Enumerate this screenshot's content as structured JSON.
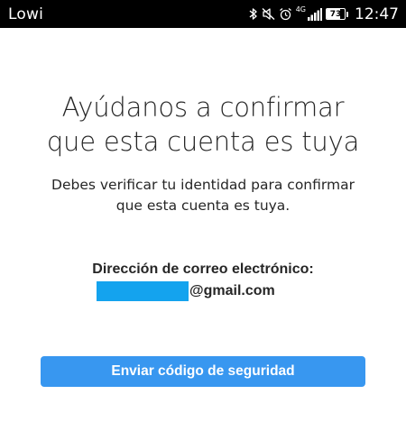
{
  "status_bar": {
    "carrier": "Lowi",
    "network_type": "4G",
    "battery_level": "73",
    "battery_fraction": 0.73,
    "time": "12:47",
    "icons": [
      "bluetooth-icon",
      "mute-icon",
      "alarm-icon",
      "network-type-icon",
      "signal-icon",
      "battery-icon"
    ]
  },
  "main": {
    "title_lines": [
      "Ayúdanos a confirmar",
      "que esta cuenta es tuya"
    ],
    "subtitle_lines": [
      "Debes verificar tu identidad para confirmar",
      "que esta cuenta es tuya."
    ],
    "email_label": "Dirección de correo electrónico:",
    "email_domain": "@gmail.com",
    "redaction_color": "#14a3ee",
    "send_code_button": "Enviar código de seguridad",
    "accent_color": "#3897f0"
  }
}
